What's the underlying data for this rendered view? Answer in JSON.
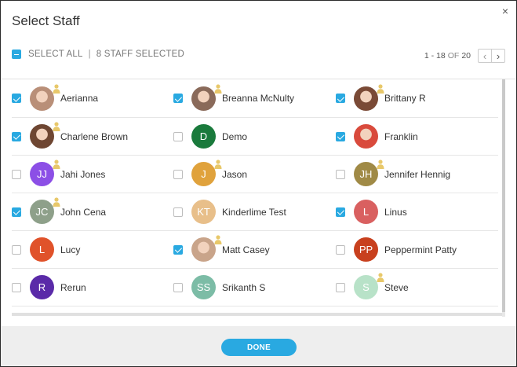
{
  "dialog": {
    "title": "Select Staff",
    "close_glyph": "×",
    "select_all_label": "SELECT ALL",
    "separator": "|",
    "selected_summary": "8 STAFF SELECTED",
    "pager": {
      "range": "1 - 18",
      "of": "OF",
      "total": "20",
      "prev_glyph": "‹",
      "next_glyph": "›"
    },
    "done_label": "DONE"
  },
  "colors": {
    "accent": "#29a9e1",
    "badge": "#e8c86a"
  },
  "staff_rows": [
    [
      {
        "name": "Aerianna",
        "initials": "",
        "avatar_type": "photo",
        "avatar_color": "#b98f78",
        "checked": true,
        "badge": true
      },
      {
        "name": "Breanna McNulty",
        "initials": "",
        "avatar_type": "photo",
        "avatar_color": "#8a6a5a",
        "checked": true,
        "badge": true
      },
      {
        "name": "Brittany R",
        "initials": "",
        "avatar_type": "photo",
        "avatar_color": "#7a4a36",
        "checked": true,
        "badge": true
      }
    ],
    [
      {
        "name": "Charlene Brown",
        "initials": "",
        "avatar_type": "photo",
        "avatar_color": "#6e4632",
        "checked": true,
        "badge": true
      },
      {
        "name": "Demo",
        "initials": "D",
        "avatar_type": "initials",
        "avatar_color": "#1a7a3c",
        "checked": false,
        "badge": false
      },
      {
        "name": "Franklin",
        "initials": "",
        "avatar_type": "photo",
        "avatar_color": "#d94a3c",
        "checked": true,
        "badge": false
      }
    ],
    [
      {
        "name": "Jahi Jones",
        "initials": "JJ",
        "avatar_type": "initials",
        "avatar_color": "#8c4fe6",
        "checked": false,
        "badge": true
      },
      {
        "name": "Jason",
        "initials": "J",
        "avatar_type": "initials",
        "avatar_color": "#e0a23c",
        "checked": false,
        "badge": true
      },
      {
        "name": "Jennifer Hennig",
        "initials": "JH",
        "avatar_type": "initials",
        "avatar_color": "#a08a46",
        "checked": false,
        "badge": true
      }
    ],
    [
      {
        "name": "John Cena",
        "initials": "JC",
        "avatar_type": "initials",
        "avatar_color": "#8ea08a",
        "checked": true,
        "badge": true
      },
      {
        "name": "Kinderlime Test",
        "initials": "KT",
        "avatar_type": "initials",
        "avatar_color": "#e8bf8a",
        "checked": false,
        "badge": false
      },
      {
        "name": "Linus",
        "initials": "L",
        "avatar_type": "initials",
        "avatar_color": "#d96060",
        "checked": true,
        "badge": false
      }
    ],
    [
      {
        "name": "Lucy",
        "initials": "L",
        "avatar_type": "initials",
        "avatar_color": "#e0522a",
        "checked": false,
        "badge": false
      },
      {
        "name": "Matt Casey",
        "initials": "",
        "avatar_type": "photo",
        "avatar_color": "#c9a48a",
        "checked": true,
        "badge": true
      },
      {
        "name": "Peppermint Patty",
        "initials": "PP",
        "avatar_type": "initials",
        "avatar_color": "#c8401e",
        "checked": false,
        "badge": false
      }
    ],
    [
      {
        "name": "Rerun",
        "initials": "R",
        "avatar_type": "initials",
        "avatar_color": "#5a2aa8",
        "checked": false,
        "badge": false
      },
      {
        "name": "Srikanth S",
        "initials": "SS",
        "avatar_type": "initials",
        "avatar_color": "#7cbca6",
        "checked": false,
        "badge": false
      },
      {
        "name": "Steve",
        "initials": "S",
        "avatar_type": "initials",
        "avatar_color": "#b8e2c8",
        "checked": false,
        "badge": true
      }
    ]
  ]
}
